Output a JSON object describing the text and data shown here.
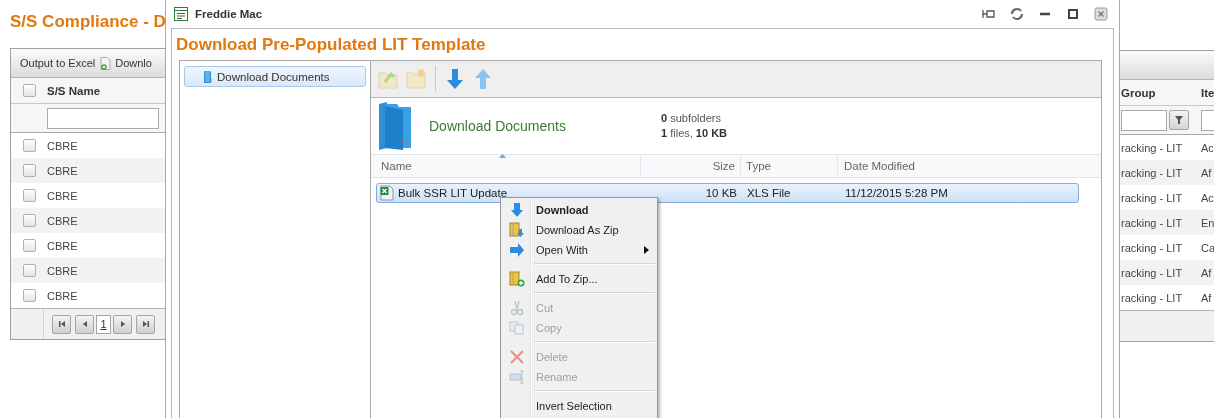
{
  "page": {
    "title": "S/S Compliance - D"
  },
  "grid_left": {
    "toolbar": [
      {
        "label": "Output to Excel",
        "kind": "text"
      },
      {
        "label": "Downlo",
        "kind": "icon"
      }
    ],
    "select_all_checked": false,
    "columns": [
      "S/S Name"
    ],
    "rows": [
      {
        "name": "CBRE",
        "checked": false
      },
      {
        "name": "CBRE",
        "checked": false
      },
      {
        "name": "CBRE",
        "checked": false
      },
      {
        "name": "CBRE",
        "checked": false
      },
      {
        "name": "CBRE",
        "checked": false
      },
      {
        "name": "CBRE",
        "checked": false
      },
      {
        "name": "CBRE",
        "checked": false
      }
    ],
    "pager": {
      "page": "1"
    }
  },
  "dialog": {
    "title": "Freddie Mac",
    "heading": "Download Pre-Populated LIT Template",
    "tree": [
      {
        "label": "Download Documents",
        "selected": true
      }
    ],
    "folder": {
      "name": "Download Documents",
      "subfolders": "**0** subfolders",
      "files": "**1** files, **10 KB**"
    },
    "columns": [
      "Name",
      "Size",
      "Type",
      "Date Modified"
    ],
    "files": [
      {
        "name": "Bulk SSR LIT Update",
        "size": "10 KB",
        "type": "XLS File",
        "modified": "11/12/2015 5:28 PM",
        "selected": true
      }
    ],
    "context_menu": [
      [
        {
          "label": "Download",
          "default": true,
          "disabled": false
        },
        {
          "label": "Download As Zip",
          "default": false,
          "disabled": false
        },
        {
          "label": "Open With",
          "default": false,
          "disabled": false,
          "submenu": true
        }
      ],
      [
        {
          "label": "Add To Zip...",
          "default": false,
          "disabled": false
        }
      ],
      [
        {
          "label": "Cut",
          "default": false,
          "disabled": true
        },
        {
          "label": "Copy",
          "default": false,
          "disabled": true
        }
      ],
      [
        {
          "label": "Delete",
          "default": false,
          "disabled": true
        },
        {
          "label": "Rename",
          "default": false,
          "disabled": true
        }
      ],
      [
        {
          "label": "Invert Selection",
          "default": false,
          "disabled": false
        }
      ]
    ]
  },
  "grid_right": {
    "columns": [
      "Group",
      "Ite"
    ],
    "rows": [
      {
        "group": "racking - LIT",
        "item": "Ac"
      },
      {
        "group": "racking - LIT",
        "item": "Af"
      },
      {
        "group": "racking - LIT",
        "item": "Ac"
      },
      {
        "group": "racking - LIT",
        "item": "En"
      },
      {
        "group": "racking - LIT",
        "item": "Ca"
      },
      {
        "group": "racking - LIT",
        "item": "Af"
      },
      {
        "group": "racking - LIT",
        "item": "Af"
      }
    ]
  }
}
